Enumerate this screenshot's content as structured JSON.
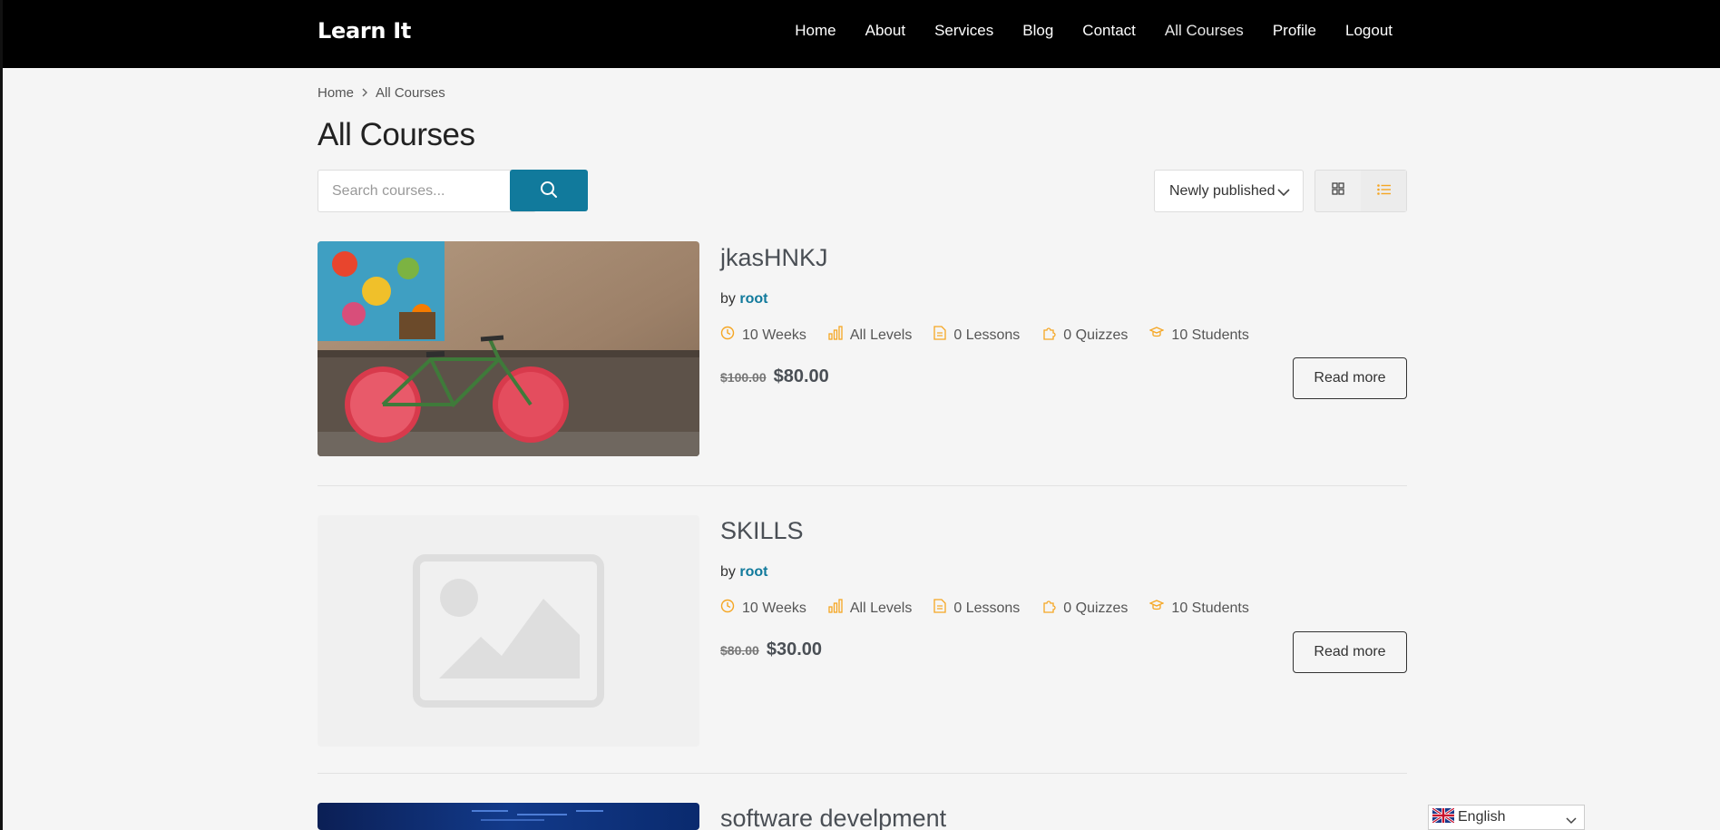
{
  "header": {
    "logo": "Learn It",
    "nav": [
      "Home",
      "About",
      "Services",
      "Blog",
      "Contact",
      "All Courses",
      "Profile",
      "Logout"
    ]
  },
  "breadcrumb": [
    "Home",
    "All Courses"
  ],
  "page_title": "All Courses",
  "search": {
    "placeholder": "Search courses..."
  },
  "sort": {
    "selected": "Newly published"
  },
  "view": {
    "active": "list",
    "accent": "#f5a623"
  },
  "colors": {
    "brand": "#117a9c",
    "icon_accent": "#f5a623"
  },
  "courses": [
    {
      "title": "jkasHNKJ",
      "by": "by",
      "author": "root",
      "duration": "10 Weeks",
      "level": "All Levels",
      "lessons": "0 Lessons",
      "quizzes": "0 Quizzes",
      "students": "10 Students",
      "old_price": "$100.00",
      "price": "$80.00",
      "cta": "Read more",
      "image": "bicycle-photo"
    },
    {
      "title": "SKILLS",
      "by": "by",
      "author": "root",
      "duration": "10 Weeks",
      "level": "All Levels",
      "lessons": "0 Lessons",
      "quizzes": "0 Quizzes",
      "students": "10 Students",
      "old_price": "$80.00",
      "price": "$30.00",
      "cta": "Read more",
      "image": "placeholder-image"
    },
    {
      "title": "software develpment",
      "image": "code-screen-photo"
    }
  ],
  "language": {
    "label": "English"
  }
}
